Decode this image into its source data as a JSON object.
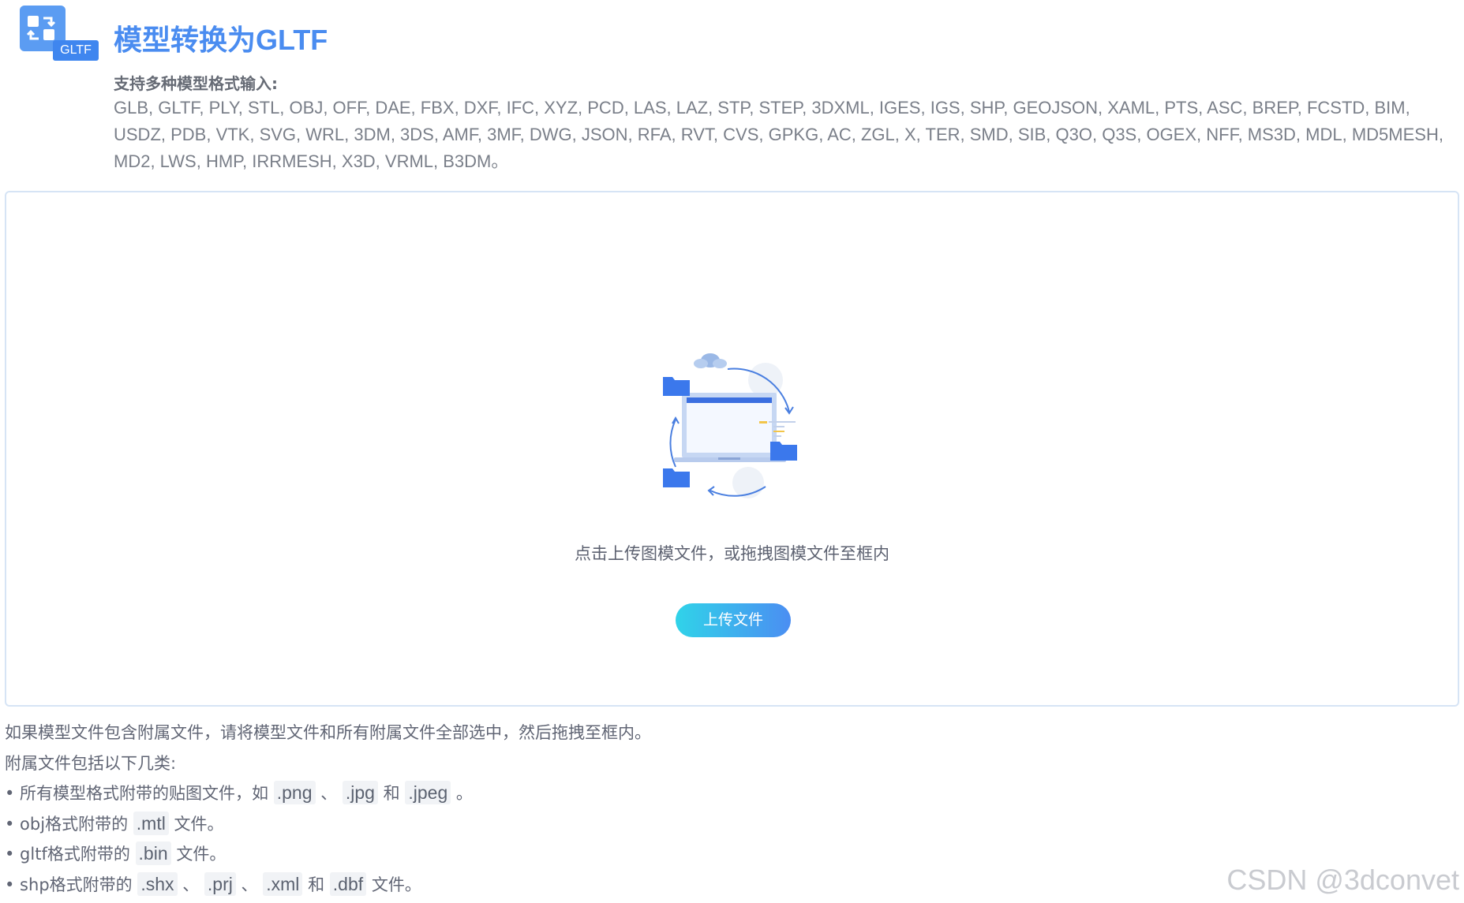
{
  "header": {
    "logo_tag": "GLTF",
    "title": "模型转换为GLTF",
    "formats_heading": "支持多种模型格式输入:",
    "formats_list": "GLB, GLTF, PLY, STL, OBJ, OFF, DAE, FBX, DXF, IFC, XYZ, PCD, LAS, LAZ, STP, STEP, 3DXML, IGES, IGS, SHP, GEOJSON, XAML, PTS, ASC, BREP, FCSTD, BIM, USDZ, PDB, VTK, SVG, WRL, 3DM, 3DS, AMF, 3MF, DWG, JSON, RFA, RVT, CVS, GPKG, AC, ZGL, X, TER, SMD, SIB, Q3O, Q3S, OGEX, NFF, MS3D, MDL, MD5MESH, MD2, LWS, HMP, IRRMESH, X3D, VRML, B3DM。"
  },
  "upload": {
    "drop_text": "点击上传图模文件，或拖拽图模文件至框内",
    "button_label": "上传文件"
  },
  "notes": {
    "line1": "如果模型文件包含附属文件，请将模型文件和所有附属文件全部选中，然后拖拽至框内。",
    "line2": "附属文件包括以下几类:",
    "item1": {
      "prefix": "• 所有模型格式附带的贴图文件，如",
      "ext1": ".png",
      "sep1": "、",
      "ext2": ".jpg",
      "and": "和",
      "ext3": ".jpeg",
      "suffix": "。"
    },
    "item2": {
      "prefix": "• obj格式附带的",
      "ext1": ".mtl",
      "suffix": "文件。"
    },
    "item3": {
      "prefix": "• gltf格式附带的",
      "ext1": ".bin",
      "suffix": "文件。"
    },
    "item4": {
      "prefix": "• shp格式附带的",
      "ext1": ".shx",
      "sep1": "、",
      "ext2": ".prj",
      "sep2": "、",
      "ext3": ".xml",
      "and": "和",
      "ext4": ".dbf",
      "suffix": "文件。"
    }
  },
  "watermark": "CSDN @3dconvet",
  "colors": {
    "accent": "#4a8cf0",
    "button_gradient_start": "#30d3e9",
    "button_gradient_end": "#4b8ef2",
    "box_border": "#d6e4f5"
  },
  "icons": {
    "logo": "convert-gltf-icon",
    "illustration": "upload-folders-illustration"
  }
}
